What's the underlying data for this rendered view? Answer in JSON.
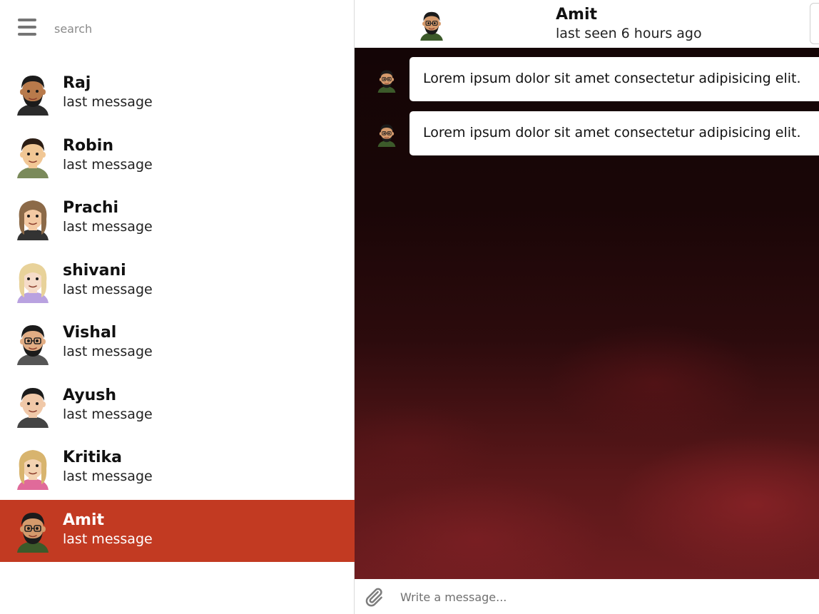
{
  "sidebar": {
    "search": {
      "placeholder": "search"
    },
    "icons": {
      "menu": "hamburger-menu-icon"
    },
    "chats": [
      {
        "name": "Raj",
        "last_message": "last message",
        "active": false,
        "skin": "#b87a4b",
        "hair": "#1b1b1b",
        "beard": "#1b1b1b",
        "glasses": false,
        "shirt": "#2b2b2b"
      },
      {
        "name": "Robin",
        "last_message": "last message",
        "active": false,
        "skin": "#f1c795",
        "hair": "#2b1d14",
        "beard": "",
        "glasses": false,
        "shirt": "#7a8a5a"
      },
      {
        "name": "Prachi",
        "last_message": "last message",
        "active": false,
        "skin": "#f3c9a3",
        "hair": "#8c6a48",
        "beard": "",
        "glasses": false,
        "shirt": "#333333"
      },
      {
        "name": "shivani",
        "last_message": "last message",
        "active": false,
        "skin": "#f6dcc9",
        "hair": "#e8d29a",
        "beard": "",
        "glasses": false,
        "shirt": "#b9a2e0"
      },
      {
        "name": "Vishal",
        "last_message": "last message",
        "active": false,
        "skin": "#e2ad84",
        "hair": "#1b1b1b",
        "beard": "#1b1b1b",
        "glasses": true,
        "shirt": "#555555"
      },
      {
        "name": "Ayush",
        "last_message": "last message",
        "active": false,
        "skin": "#f0c8a8",
        "hair": "#1b1b1b",
        "beard": "",
        "glasses": false,
        "shirt": "#444444"
      },
      {
        "name": "Kritika",
        "last_message": "last message",
        "active": false,
        "skin": "#f3d2b1",
        "hair": "#d8b46e",
        "beard": "",
        "glasses": false,
        "shirt": "#e06a9a"
      },
      {
        "name": "Amit",
        "last_message": "last message",
        "active": true,
        "skin": "#d59a6c",
        "hair": "#1b1b1b",
        "beard": "#1b1b1b",
        "glasses": true,
        "shirt": "#3c5a2a"
      }
    ]
  },
  "chat": {
    "contact_name": "Amit",
    "status": "last seen 6 hours ago",
    "messages": [
      {
        "text": "Lorem ipsum dolor sit amet consectetur adipisicing elit."
      },
      {
        "text": "Lorem ipsum dolor sit amet consectetur adipisicing elit."
      }
    ],
    "composer": {
      "placeholder": "Write a message..."
    },
    "icons": {
      "attach": "paperclip-icon"
    }
  },
  "colors": {
    "accent": "#c23a22",
    "chat_bg_dark": "#140506",
    "chat_bg_red": "#6f1d20",
    "icon_gray": "#757575"
  }
}
